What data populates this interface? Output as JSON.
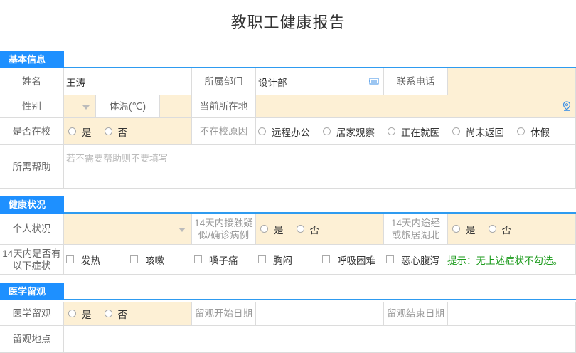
{
  "page_title": "教职工健康报告",
  "sections": {
    "basic": "基本信息",
    "health": "健康状况",
    "medical": "医学留观"
  },
  "basic": {
    "name_label": "姓名",
    "name_value": "王涛",
    "dept_label": "所属部门",
    "dept_value": "设计部",
    "phone_label": "联系电话",
    "gender_label": "性别",
    "temp_label": "体温(℃)",
    "location_label": "当前所在地",
    "at_school_label": "是否在校",
    "yes": "是",
    "no": "否",
    "absent_reason_label": "不在校原因",
    "reasons": [
      "远程办公",
      "居家观察",
      "正在就医",
      "尚未返回",
      "休假"
    ],
    "help_label": "所需帮助",
    "help_placeholder": "若不需要帮助则不要填写"
  },
  "health": {
    "personal_label": "个人状况",
    "contact_label": "14天内接触疑似/确诊病例",
    "hubei_label": "14天内途经或旅居湖北",
    "yes": "是",
    "no": "否",
    "symptoms_label": "14天内是否有以下症状",
    "symptoms": [
      "发热",
      "咳嗽",
      "嗓子痛",
      "胸闷",
      "呼吸困难",
      "恶心腹泻"
    ],
    "hint": "提示：无上述症状不勾选。"
  },
  "medical": {
    "observe_label": "医学留观",
    "yes": "是",
    "no": "否",
    "start_label": "留观开始日期",
    "end_label": "留观结束日期",
    "place_label": "留观地点"
  },
  "icons": {
    "dept_picker": "org-tree-icon",
    "location_picker": "map-pin-icon"
  },
  "colors": {
    "accent": "#1e90ff",
    "field_highlight": "#fdf0d5",
    "hint": "#1a9a1a"
  }
}
